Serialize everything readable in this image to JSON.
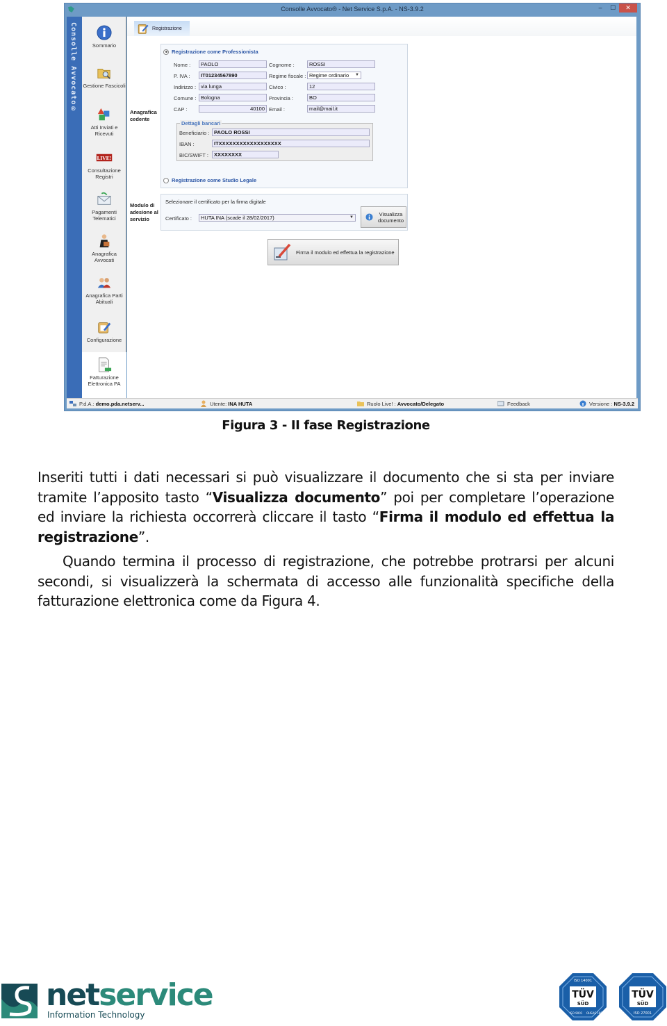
{
  "window": {
    "title": "Consolle Avvocato® - Net Service S.p.A. - NS-3.9.2",
    "controls": {
      "minimize": "‒",
      "maximize": "☐",
      "close": "✕"
    },
    "vertical_brand": "Consolle Avvocato®"
  },
  "sidebar": {
    "items": [
      {
        "label": "Sommario",
        "icon": "info-icon"
      },
      {
        "label": "Gestione Fascicoli",
        "icon": "folder-search-icon"
      },
      {
        "label": "Atti Inviati e Ricevuti",
        "icon": "shapes-icon"
      },
      {
        "label": "Consultazione Registri",
        "icon": "live-badge-icon",
        "badge": "LIVE!"
      },
      {
        "label": "Pagamenti Telematici",
        "icon": "envelope-icon"
      },
      {
        "label": "Anagrafica Avvocati",
        "icon": "lawyer-icon"
      },
      {
        "label": "Anagrafica Parti Abituali",
        "icon": "people-icon"
      },
      {
        "label": "Configurazione",
        "icon": "config-icon"
      },
      {
        "label": "Fatturazione Elettronica PA",
        "icon": "invoice-icon",
        "active": true
      }
    ]
  },
  "tab": {
    "label": "Registrazione"
  },
  "form": {
    "section_anagrafica": "Anagrafica cedente",
    "section_modulo": "Modulo di adesione al servizio",
    "radio_professionista": {
      "label": "Registrazione come Professionista",
      "selected": true
    },
    "radio_studio": {
      "label": "Registrazione come Studio Legale",
      "selected": false
    },
    "fields": {
      "nome": {
        "label": "Nome :",
        "value": "PAOLO"
      },
      "cognome": {
        "label": "Cognome :",
        "value": "ROSSI"
      },
      "piva": {
        "label": "P. IVA :",
        "value": "IT01234567890"
      },
      "regime": {
        "label": "Regime fiscale :",
        "value": "Regime ordinario"
      },
      "indirizzo": {
        "label": "Indirizzo :",
        "value": "via lunga"
      },
      "civico": {
        "label": "Civico :",
        "value": "12"
      },
      "comune": {
        "label": "Comune :",
        "value": "Bologna"
      },
      "provincia": {
        "label": "Provincia :",
        "value": "BO"
      },
      "cap": {
        "label": "CAP :",
        "value": "40100"
      },
      "email": {
        "label": "Email :",
        "value": "mail@mail.it"
      }
    },
    "bank": {
      "title": "Dettagli bancari",
      "beneficiario": {
        "label": "Beneficiario :",
        "value": "PAOLO ROSSI"
      },
      "iban": {
        "label": "IBAN :",
        "value": "ITXXXXXXXXXXXXXXXXXX"
      },
      "bic": {
        "label": "BIC/SWIFT :",
        "value": "XXXXXXXX"
      }
    },
    "certificate": {
      "heading": "Selezionare il certificato per la firma digitale",
      "label": "Certificato :",
      "value": "HUTA INA (scade il 28/02/2017)"
    },
    "view_button": "Visualizza documento",
    "sign_button": "Firma il modulo ed effettua la registrazione"
  },
  "statusbar": {
    "pda_label": "P.d.A.:",
    "pda_value": "demo.pda.netserv...",
    "user_label": "Utente:",
    "user_value": "INA HUTA",
    "role_label": "Ruolo Live! :",
    "role_value": "Avvocato/Delegato",
    "feedback": "Feedback",
    "version_label": "Versione :",
    "version_value": "NS-3.9.2"
  },
  "document": {
    "caption": "Figura 3 - II fase Registrazione",
    "p1_a": "Inseriti tutti i dati necessari si può visualizzare il documento che si sta per inviare tramite l’apposito tasto “",
    "p1_b": "Visualizza documento",
    "p1_c": "” poi per completare l’operazione ed inviare la richiesta occorrerà cliccare il tasto “",
    "p1_d": "Firma il modulo ed effettua la registrazione",
    "p1_e": "”.",
    "p2": "Quando termina il processo di registrazione, che potrebbe protrarsi per alcuni secondi, si visualizzerà la schermata di accesso alle funzionalità specifiche della fatturazione elettronica come da Figura 4."
  },
  "footer": {
    "logo_a": "net",
    "logo_b": "service",
    "logo_sub": "Information Technology",
    "badges": [
      {
        "brand": "TÜV",
        "sub": "SÜD",
        "certs": [
          "ISO 14001",
          "ISO 9001",
          "OHSAS 18001"
        ]
      },
      {
        "brand": "TÜV",
        "sub": "SÜD",
        "certs": [
          "ISO 27001"
        ]
      }
    ]
  },
  "colors": {
    "titlebar": "#6e9bc6",
    "vbar": "#3a6db7",
    "accent_blue": "#2a55a5",
    "logo_dark": "#174a55",
    "logo_teal": "#2c8a7a",
    "tuv_blue": "#1a5fa8"
  }
}
